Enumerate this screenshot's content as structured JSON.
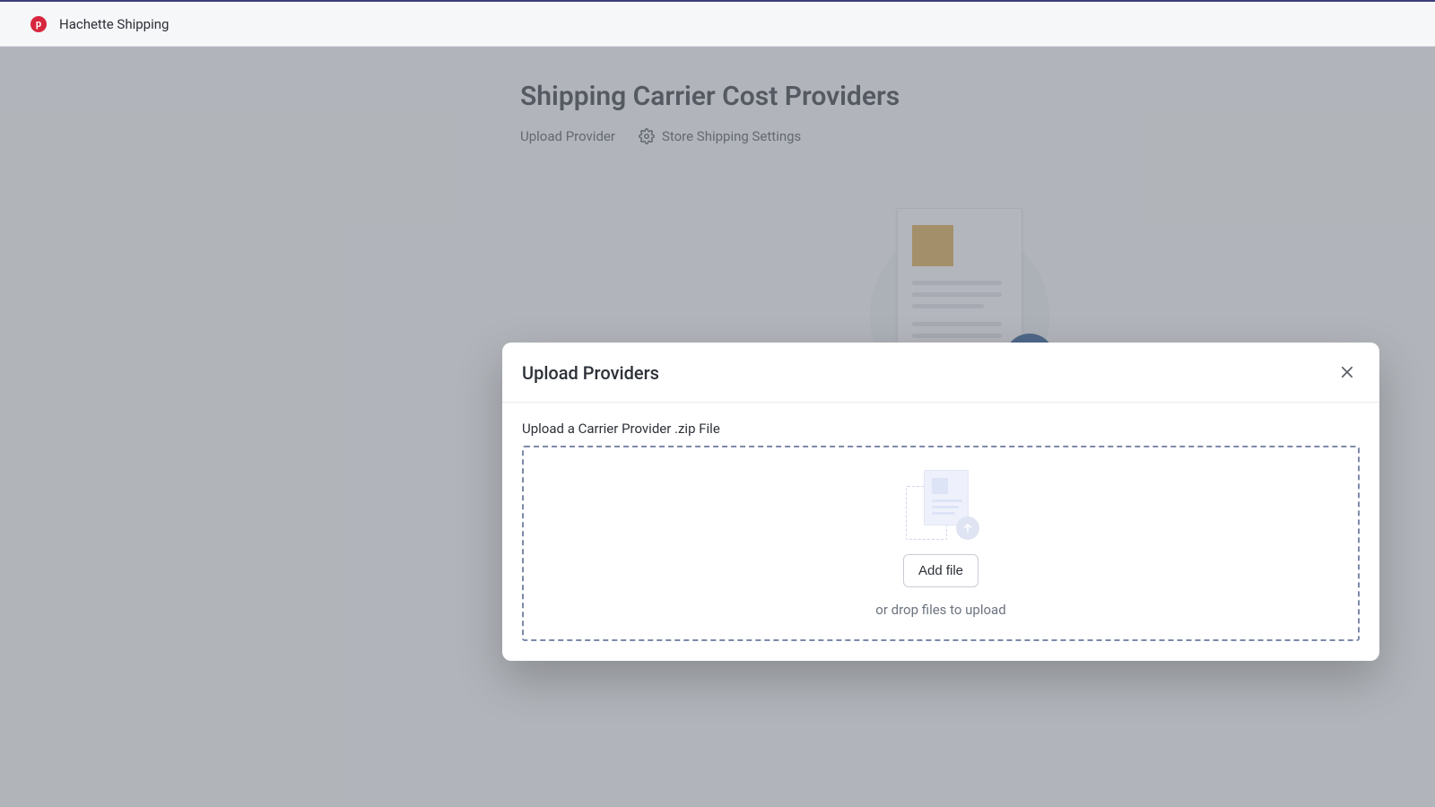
{
  "appbar": {
    "brand_glyph": "p",
    "brand_name": "Hachette Shipping"
  },
  "page": {
    "title": "Shipping Carrier Cost Providers",
    "actions": {
      "upload_label": "Upload Provider",
      "settings_label": "Store Shipping Settings"
    }
  },
  "modal": {
    "title": "Upload Providers",
    "field_label": "Upload a Carrier Provider .zip File",
    "add_file_label": "Add file",
    "drop_hint": "or drop files to upload"
  }
}
